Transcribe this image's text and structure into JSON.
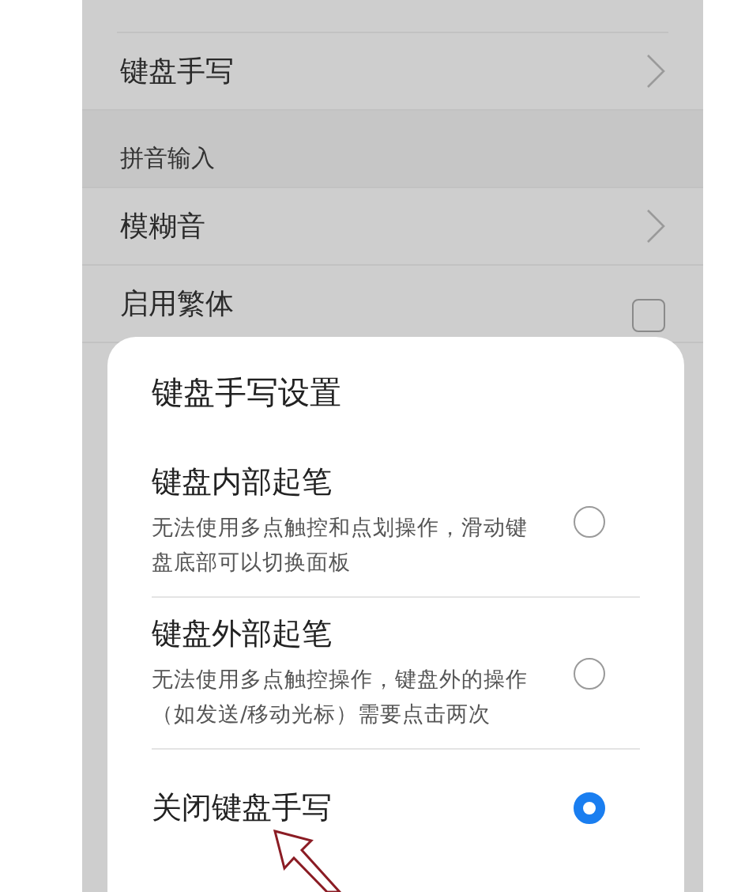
{
  "background_list": {
    "rows": [
      {
        "kind": "link",
        "label": "键盘手写"
      },
      {
        "kind": "header",
        "label": "拼音输入"
      },
      {
        "kind": "link",
        "label": "模糊音"
      },
      {
        "kind": "checkbox",
        "label": "启用繁体",
        "checked": false
      }
    ]
  },
  "dialog": {
    "title": "键盘手写设置",
    "options": [
      {
        "label": "键盘内部起笔",
        "description": "无法使用多点触控和点划操作，滑动键盘底部可以切换面板",
        "selected": false
      },
      {
        "label": "键盘外部起笔",
        "description": "无法使用多点触控操作，键盘外的操作（如发送/移动光标）需要点击两次",
        "selected": false
      },
      {
        "label": "关闭键盘手写",
        "selected": true
      }
    ]
  }
}
